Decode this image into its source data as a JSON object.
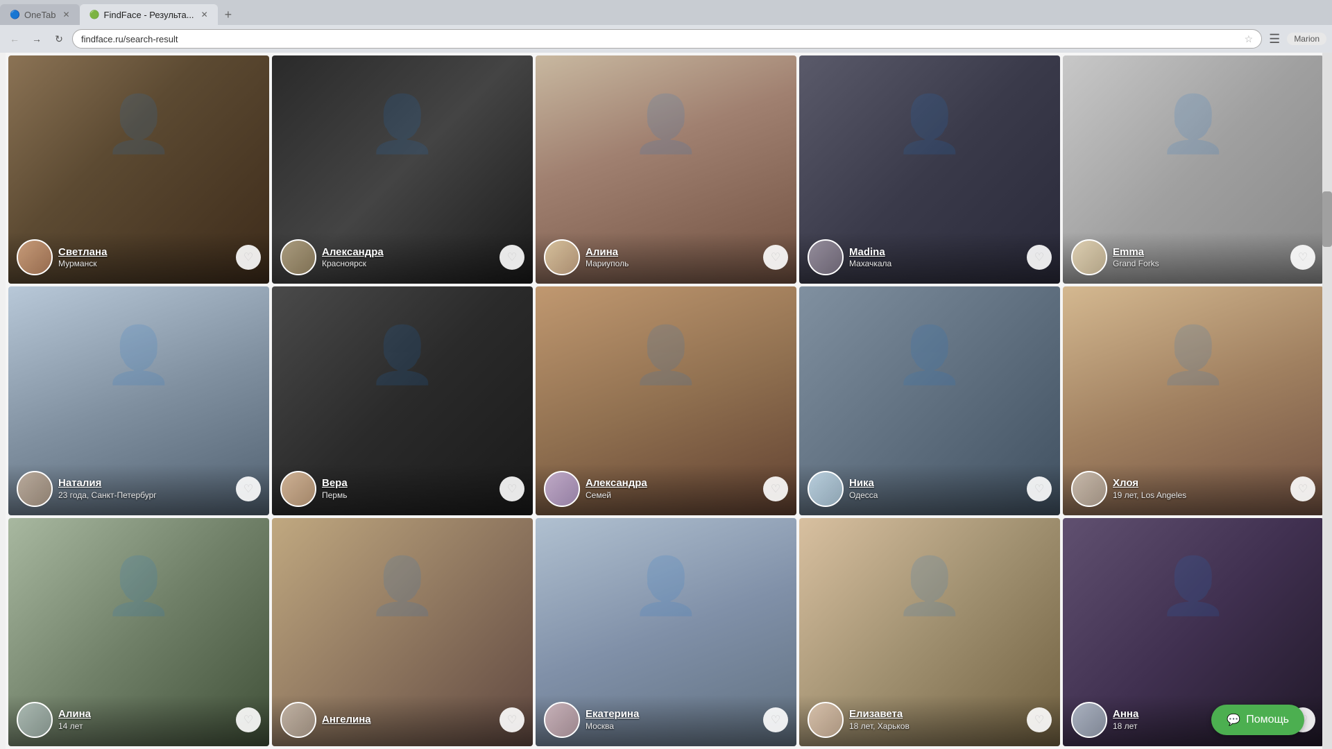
{
  "browser": {
    "tabs": [
      {
        "id": "tab1",
        "label": "OneTab",
        "active": false,
        "favicon": "🔵"
      },
      {
        "id": "tab2",
        "label": "FindFace - Результа...",
        "active": true,
        "favicon": "🟢"
      }
    ],
    "address": "findface.ru/search-result",
    "user": "Marion"
  },
  "cards": [
    {
      "id": 1,
      "name": "Светлана",
      "sub": "Мурманск",
      "bg": "card-bg-1",
      "av": "av-1"
    },
    {
      "id": 2,
      "name": "Александра",
      "sub": "Красноярск",
      "bg": "card-bg-2",
      "av": "av-2"
    },
    {
      "id": 3,
      "name": "Алина",
      "sub": "Мариуполь",
      "bg": "card-bg-3",
      "av": "av-3"
    },
    {
      "id": 4,
      "name": "Madina",
      "sub": "Махачкала",
      "bg": "card-bg-4",
      "av": "av-4"
    },
    {
      "id": 5,
      "name": "Emma",
      "sub": "Grand Forks",
      "bg": "card-bg-5",
      "av": "av-5"
    },
    {
      "id": 6,
      "name": "Наталия",
      "sub": "23 года, Санкт-Петербург",
      "bg": "card-bg-6",
      "av": "av-6"
    },
    {
      "id": 7,
      "name": "Вера",
      "sub": "Пермь",
      "bg": "card-bg-7",
      "av": "av-7"
    },
    {
      "id": 8,
      "name": "Александра",
      "sub": "Семей",
      "bg": "card-bg-8",
      "av": "av-8"
    },
    {
      "id": 9,
      "name": "Ника",
      "sub": "Одесса",
      "bg": "card-bg-9",
      "av": "av-9"
    },
    {
      "id": 10,
      "name": "Хлоя",
      "sub": "19 лет, Los Angeles",
      "bg": "card-bg-10",
      "av": "av-10"
    },
    {
      "id": 11,
      "name": "Алина",
      "sub": "14 лет",
      "bg": "card-bg-11",
      "av": "av-11"
    },
    {
      "id": 12,
      "name": "Ангелина",
      "sub": "",
      "bg": "card-bg-12",
      "av": "av-12"
    },
    {
      "id": 13,
      "name": "Екатерина",
      "sub": "Москва",
      "bg": "card-bg-13",
      "av": "av-13"
    },
    {
      "id": 14,
      "name": "Елизавета",
      "sub": "18 лет, Харьков",
      "bg": "card-bg-14",
      "av": "av-14"
    },
    {
      "id": 15,
      "name": "Анна",
      "sub": "18 лет",
      "bg": "card-bg-15",
      "av": "av-15"
    }
  ],
  "help_button": "Помощь"
}
